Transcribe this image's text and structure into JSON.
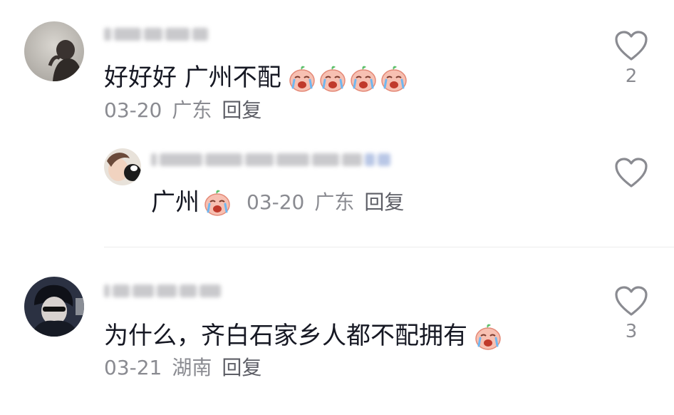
{
  "comments": [
    {
      "text": "好好好 广州不配",
      "emoji_count": 4,
      "date": "03-20",
      "location": "广东",
      "reply_label": "回复",
      "like_count": "2"
    },
    {
      "text": "为什么，齐白石家乡人都不配拥有",
      "emoji_count": 1,
      "date": "03-21",
      "location": "湖南",
      "reply_label": "回复",
      "like_count": "3"
    }
  ],
  "reply": {
    "text": "广州",
    "date": "03-20",
    "location": "广东",
    "reply_label": "回复"
  },
  "icons": {
    "like": "heart-outline-icon",
    "emoji": "crying-face-emoji-icon"
  },
  "colors": {
    "text": "#161823",
    "meta": "#8a8b91",
    "heart_stroke": "#8a8b91",
    "emoji_face": "#f7c0b2",
    "emoji_leaf": "#5cbf6a"
  }
}
